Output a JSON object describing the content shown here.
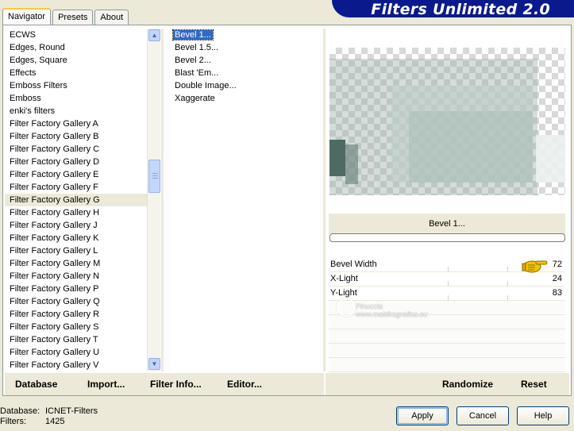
{
  "tabs": [
    {
      "label": "Navigator",
      "active": true
    },
    {
      "label": "Presets",
      "active": false
    },
    {
      "label": "About",
      "active": false
    }
  ],
  "banner": {
    "title": "Filters Unlimited 2.0"
  },
  "categories": {
    "items": [
      "ECWS",
      "Edges, Round",
      "Edges, Square",
      "Effects",
      "Emboss Filters",
      "Emboss",
      "enki's filters",
      "Filter Factory Gallery A",
      "Filter Factory Gallery B",
      "Filter Factory Gallery C",
      "Filter Factory Gallery D",
      "Filter Factory Gallery E",
      "Filter Factory Gallery F",
      "Filter Factory Gallery G",
      "Filter Factory Gallery H",
      "Filter Factory Gallery J",
      "Filter Factory Gallery K",
      "Filter Factory Gallery L",
      "Filter Factory Gallery M",
      "Filter Factory Gallery N",
      "Filter Factory Gallery P",
      "Filter Factory Gallery Q",
      "Filter Factory Gallery R",
      "Filter Factory Gallery S",
      "Filter Factory Gallery T",
      "Filter Factory Gallery U",
      "Filter Factory Gallery V"
    ],
    "selected": "Filter Factory Gallery G"
  },
  "filters": {
    "items": [
      "Bevel 1...",
      "Bevel 1.5...",
      "Bevel 2...",
      "Blast 'Em...",
      "Double Image...",
      "Xaggerate"
    ],
    "selected": "Bevel 1..."
  },
  "preview": {
    "filter_name": "Bevel 1..."
  },
  "params": [
    {
      "label": "Bevel Width",
      "value": "72"
    },
    {
      "label": "X-Light",
      "value": "24"
    },
    {
      "label": "Y-Light",
      "value": "83"
    }
  ],
  "watermark": {
    "line1": "Pinuccia",
    "line2": "www.maldiragrafica.eu"
  },
  "toolbar_left": {
    "database": "Database",
    "import": "Import...",
    "filter_info": "Filter Info...",
    "editor": "Editor..."
  },
  "toolbar_right": {
    "randomize": "Randomize",
    "reset": "Reset"
  },
  "status": {
    "database_label": "Database:",
    "database_value": "ICNET-Filters",
    "filters_label": "Filters:",
    "filters_value": "1425"
  },
  "buttons": {
    "apply": "Apply",
    "cancel": "Cancel",
    "help": "Help"
  },
  "colors": {
    "selection": "#316ac5",
    "banner": "#0a1a8c",
    "tab_highlight": "#ffc83c"
  }
}
